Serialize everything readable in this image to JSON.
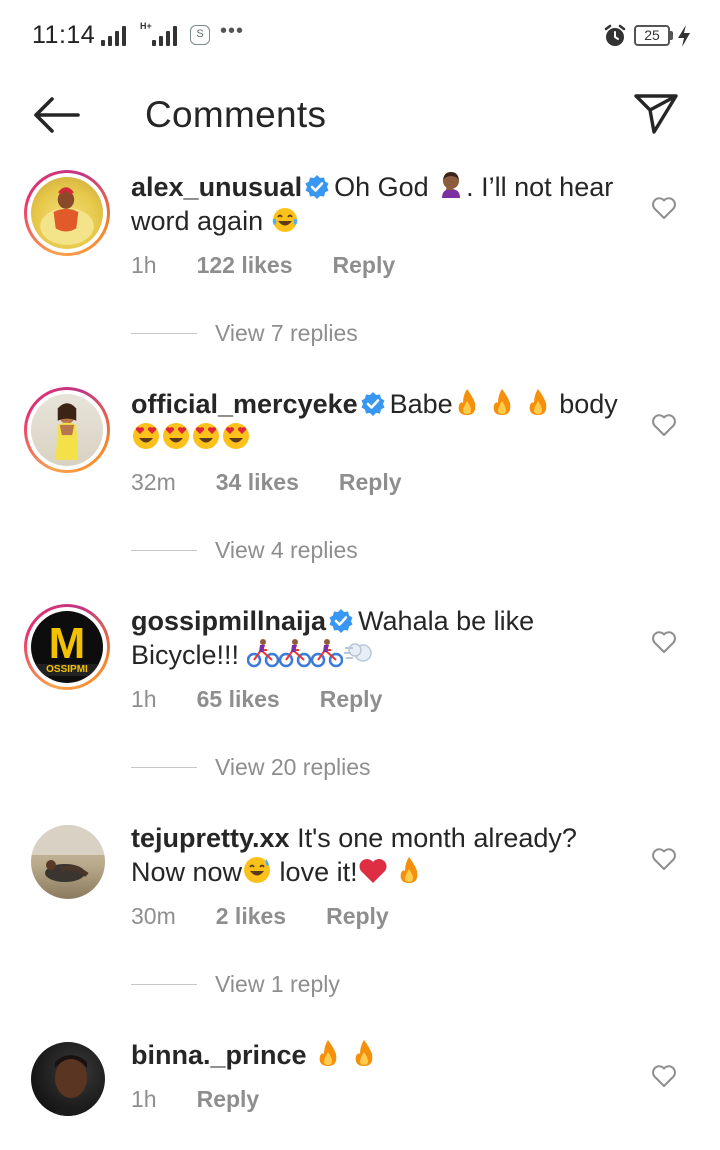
{
  "status_bar": {
    "time": "11:14",
    "network": "H+",
    "battery": "25",
    "app_icon": "S"
  },
  "header": {
    "title": "Comments",
    "back_icon": "arrow-left-icon",
    "send_icon": "paper-plane-icon"
  },
  "comments": [
    {
      "username": "alex_unusual",
      "verified": true,
      "text_1": "Oh God ",
      "text_2": ". I’ll not hear word again ",
      "time": "1h",
      "likes": "122 likes",
      "reply_label": "Reply",
      "view_replies": "View 7 replies"
    },
    {
      "username": "official_mercyeke",
      "verified": true,
      "text_1": "Babe",
      "text_2": " body ",
      "time": "32m",
      "likes": "34 likes",
      "reply_label": "Reply",
      "view_replies": "View 4 replies"
    },
    {
      "username": "gossipmillnaija",
      "verified": true,
      "text_1": "Wahala be like Bicycle!!! ",
      "time": "1h",
      "likes": "65 likes",
      "reply_label": "Reply",
      "view_replies": "View 20 replies",
      "avatar_letter": "M",
      "avatar_text": "OSSIPMI"
    },
    {
      "username": "tejupretty.xx",
      "verified": false,
      "text_1": "It's one month already? Now now",
      "text_2": " love it!",
      "time": "30m",
      "likes": "2 likes",
      "reply_label": "Reply",
      "view_replies": "View 1 reply"
    },
    {
      "username": "binna._prince",
      "verified": false,
      "text_1": "",
      "time": "1h",
      "reply_label": "Reply"
    }
  ],
  "colors": {
    "text": "#262626",
    "secondary": "#8e8e8e",
    "verified": "#3897f0",
    "divider": "#c7c7c7"
  }
}
